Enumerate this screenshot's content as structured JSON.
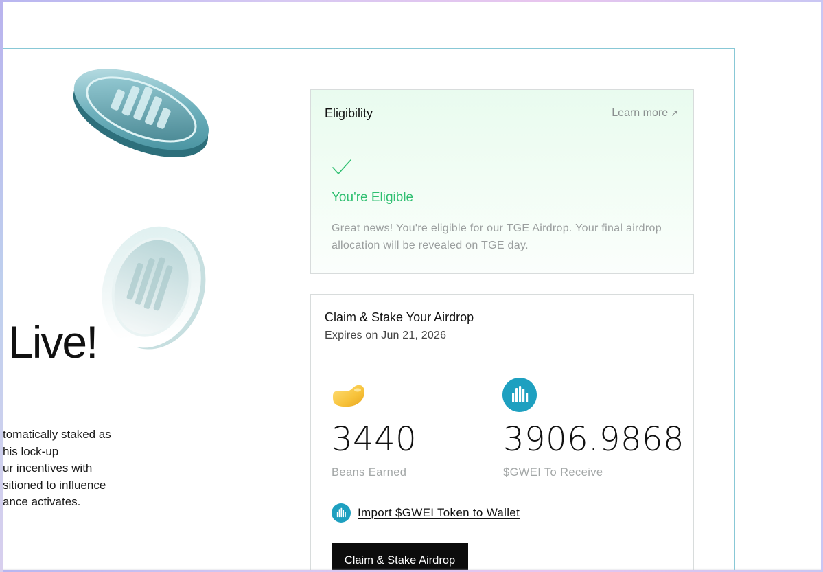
{
  "hero": {
    "heading_fragment": "Live!",
    "description_lines": [
      "tomatically staked as",
      "his lock-up",
      "ur incentives with",
      "sitioned to influence",
      "ance activates."
    ]
  },
  "eligibility": {
    "title": "Eligibility",
    "learn_more_label": "Learn more",
    "status": "You're Eligible",
    "body": "Great news! You're eligible for our TGE Airdrop. Your final airdrop allocation will be revealed on TGE day.",
    "accent_color": "#2fbf71"
  },
  "claim": {
    "title": "Claim & Stake Your Airdrop",
    "expiry": "Expires on Jun 21, 2026",
    "beans": {
      "value": "3440",
      "label": "Beans Earned",
      "icon": "bean-icon"
    },
    "gwei": {
      "value": "3906.9868",
      "label": "$GWEI To Receive",
      "icon": "gwei-token-icon",
      "color": "#1ea0c0"
    },
    "import_label": "Import $GWEI Token to Wallet",
    "button_label": "Claim & Stake Airdrop"
  }
}
